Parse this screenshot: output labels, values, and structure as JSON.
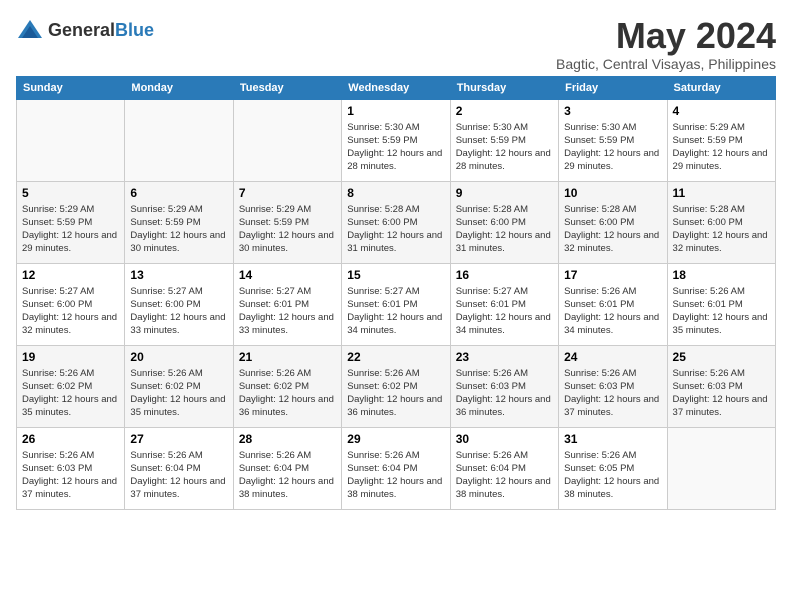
{
  "header": {
    "logo_general": "General",
    "logo_blue": "Blue",
    "title": "May 2024",
    "subtitle": "Bagtic, Central Visayas, Philippines"
  },
  "weekdays": [
    "Sunday",
    "Monday",
    "Tuesday",
    "Wednesday",
    "Thursday",
    "Friday",
    "Saturday"
  ],
  "weeks": [
    [
      {
        "day": "",
        "sunrise": "",
        "sunset": "",
        "daylight": ""
      },
      {
        "day": "",
        "sunrise": "",
        "sunset": "",
        "daylight": ""
      },
      {
        "day": "",
        "sunrise": "",
        "sunset": "",
        "daylight": ""
      },
      {
        "day": "1",
        "sunrise": "Sunrise: 5:30 AM",
        "sunset": "Sunset: 5:59 PM",
        "daylight": "Daylight: 12 hours and 28 minutes."
      },
      {
        "day": "2",
        "sunrise": "Sunrise: 5:30 AM",
        "sunset": "Sunset: 5:59 PM",
        "daylight": "Daylight: 12 hours and 28 minutes."
      },
      {
        "day": "3",
        "sunrise": "Sunrise: 5:30 AM",
        "sunset": "Sunset: 5:59 PM",
        "daylight": "Daylight: 12 hours and 29 minutes."
      },
      {
        "day": "4",
        "sunrise": "Sunrise: 5:29 AM",
        "sunset": "Sunset: 5:59 PM",
        "daylight": "Daylight: 12 hours and 29 minutes."
      }
    ],
    [
      {
        "day": "5",
        "sunrise": "Sunrise: 5:29 AM",
        "sunset": "Sunset: 5:59 PM",
        "daylight": "Daylight: 12 hours and 29 minutes."
      },
      {
        "day": "6",
        "sunrise": "Sunrise: 5:29 AM",
        "sunset": "Sunset: 5:59 PM",
        "daylight": "Daylight: 12 hours and 30 minutes."
      },
      {
        "day": "7",
        "sunrise": "Sunrise: 5:29 AM",
        "sunset": "Sunset: 5:59 PM",
        "daylight": "Daylight: 12 hours and 30 minutes."
      },
      {
        "day": "8",
        "sunrise": "Sunrise: 5:28 AM",
        "sunset": "Sunset: 6:00 PM",
        "daylight": "Daylight: 12 hours and 31 minutes."
      },
      {
        "day": "9",
        "sunrise": "Sunrise: 5:28 AM",
        "sunset": "Sunset: 6:00 PM",
        "daylight": "Daylight: 12 hours and 31 minutes."
      },
      {
        "day": "10",
        "sunrise": "Sunrise: 5:28 AM",
        "sunset": "Sunset: 6:00 PM",
        "daylight": "Daylight: 12 hours and 32 minutes."
      },
      {
        "day": "11",
        "sunrise": "Sunrise: 5:28 AM",
        "sunset": "Sunset: 6:00 PM",
        "daylight": "Daylight: 12 hours and 32 minutes."
      }
    ],
    [
      {
        "day": "12",
        "sunrise": "Sunrise: 5:27 AM",
        "sunset": "Sunset: 6:00 PM",
        "daylight": "Daylight: 12 hours and 32 minutes."
      },
      {
        "day": "13",
        "sunrise": "Sunrise: 5:27 AM",
        "sunset": "Sunset: 6:00 PM",
        "daylight": "Daylight: 12 hours and 33 minutes."
      },
      {
        "day": "14",
        "sunrise": "Sunrise: 5:27 AM",
        "sunset": "Sunset: 6:01 PM",
        "daylight": "Daylight: 12 hours and 33 minutes."
      },
      {
        "day": "15",
        "sunrise": "Sunrise: 5:27 AM",
        "sunset": "Sunset: 6:01 PM",
        "daylight": "Daylight: 12 hours and 34 minutes."
      },
      {
        "day": "16",
        "sunrise": "Sunrise: 5:27 AM",
        "sunset": "Sunset: 6:01 PM",
        "daylight": "Daylight: 12 hours and 34 minutes."
      },
      {
        "day": "17",
        "sunrise": "Sunrise: 5:26 AM",
        "sunset": "Sunset: 6:01 PM",
        "daylight": "Daylight: 12 hours and 34 minutes."
      },
      {
        "day": "18",
        "sunrise": "Sunrise: 5:26 AM",
        "sunset": "Sunset: 6:01 PM",
        "daylight": "Daylight: 12 hours and 35 minutes."
      }
    ],
    [
      {
        "day": "19",
        "sunrise": "Sunrise: 5:26 AM",
        "sunset": "Sunset: 6:02 PM",
        "daylight": "Daylight: 12 hours and 35 minutes."
      },
      {
        "day": "20",
        "sunrise": "Sunrise: 5:26 AM",
        "sunset": "Sunset: 6:02 PM",
        "daylight": "Daylight: 12 hours and 35 minutes."
      },
      {
        "day": "21",
        "sunrise": "Sunrise: 5:26 AM",
        "sunset": "Sunset: 6:02 PM",
        "daylight": "Daylight: 12 hours and 36 minutes."
      },
      {
        "day": "22",
        "sunrise": "Sunrise: 5:26 AM",
        "sunset": "Sunset: 6:02 PM",
        "daylight": "Daylight: 12 hours and 36 minutes."
      },
      {
        "day": "23",
        "sunrise": "Sunrise: 5:26 AM",
        "sunset": "Sunset: 6:03 PM",
        "daylight": "Daylight: 12 hours and 36 minutes."
      },
      {
        "day": "24",
        "sunrise": "Sunrise: 5:26 AM",
        "sunset": "Sunset: 6:03 PM",
        "daylight": "Daylight: 12 hours and 37 minutes."
      },
      {
        "day": "25",
        "sunrise": "Sunrise: 5:26 AM",
        "sunset": "Sunset: 6:03 PM",
        "daylight": "Daylight: 12 hours and 37 minutes."
      }
    ],
    [
      {
        "day": "26",
        "sunrise": "Sunrise: 5:26 AM",
        "sunset": "Sunset: 6:03 PM",
        "daylight": "Daylight: 12 hours and 37 minutes."
      },
      {
        "day": "27",
        "sunrise": "Sunrise: 5:26 AM",
        "sunset": "Sunset: 6:04 PM",
        "daylight": "Daylight: 12 hours and 37 minutes."
      },
      {
        "day": "28",
        "sunrise": "Sunrise: 5:26 AM",
        "sunset": "Sunset: 6:04 PM",
        "daylight": "Daylight: 12 hours and 38 minutes."
      },
      {
        "day": "29",
        "sunrise": "Sunrise: 5:26 AM",
        "sunset": "Sunset: 6:04 PM",
        "daylight": "Daylight: 12 hours and 38 minutes."
      },
      {
        "day": "30",
        "sunrise": "Sunrise: 5:26 AM",
        "sunset": "Sunset: 6:04 PM",
        "daylight": "Daylight: 12 hours and 38 minutes."
      },
      {
        "day": "31",
        "sunrise": "Sunrise: 5:26 AM",
        "sunset": "Sunset: 6:05 PM",
        "daylight": "Daylight: 12 hours and 38 minutes."
      },
      {
        "day": "",
        "sunrise": "",
        "sunset": "",
        "daylight": ""
      }
    ]
  ]
}
